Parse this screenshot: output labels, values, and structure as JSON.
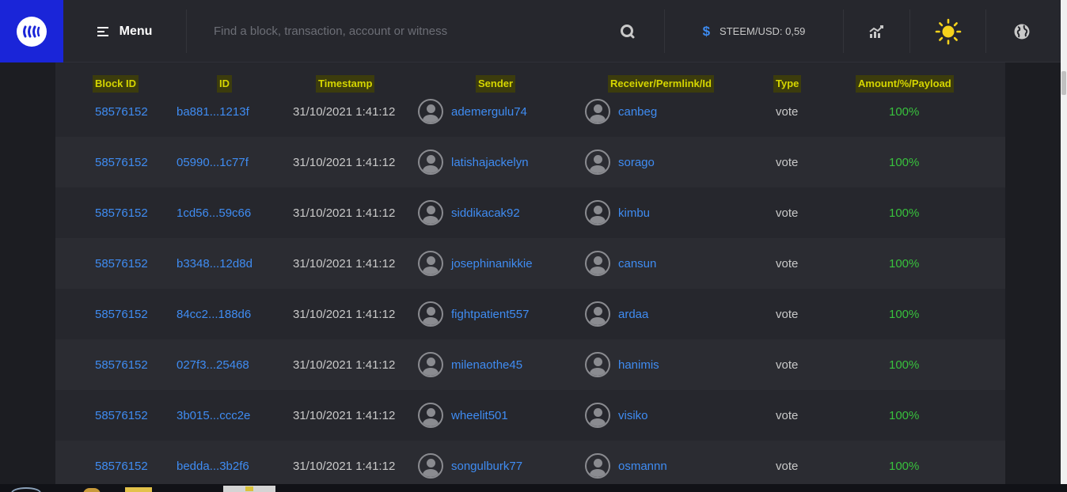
{
  "header": {
    "menu_label": "Menu",
    "search_placeholder": "Find a block, transaction, account or witness",
    "price_label": "STEEM/USD: 0,59",
    "currency_symbol": "$"
  },
  "table": {
    "columns": [
      "Block ID",
      "ID",
      "Timestamp",
      "Sender",
      "Receiver/Permlink/Id",
      "Type",
      "Amount/%/Payload"
    ],
    "rows": [
      {
        "block": "58576152",
        "id": "ba881...1213f",
        "time": "31/10/2021 1:41:12",
        "sender": "ademergulu74",
        "receiver": "canbeg",
        "type": "vote",
        "amount": "100%"
      },
      {
        "block": "58576152",
        "id": "05990...1c77f",
        "time": "31/10/2021 1:41:12",
        "sender": "latishajackelyn",
        "receiver": "sorago",
        "type": "vote",
        "amount": "100%"
      },
      {
        "block": "58576152",
        "id": "1cd56...59c66",
        "time": "31/10/2021 1:41:12",
        "sender": "siddikacak92",
        "receiver": "kimbu",
        "type": "vote",
        "amount": "100%"
      },
      {
        "block": "58576152",
        "id": "b3348...12d8d",
        "time": "31/10/2021 1:41:12",
        "sender": "josephinanikkie",
        "receiver": "cansun",
        "type": "vote",
        "amount": "100%"
      },
      {
        "block": "58576152",
        "id": "84cc2...188d6",
        "time": "31/10/2021 1:41:12",
        "sender": "fightpatient557",
        "receiver": "ardaa",
        "type": "vote",
        "amount": "100%"
      },
      {
        "block": "58576152",
        "id": "027f3...25468",
        "time": "31/10/2021 1:41:12",
        "sender": "milenaothe45",
        "receiver": "hanimis",
        "type": "vote",
        "amount": "100%"
      },
      {
        "block": "58576152",
        "id": "3b015...ccc2e",
        "time": "31/10/2021 1:41:12",
        "sender": "wheelit501",
        "receiver": "visiko",
        "type": "vote",
        "amount": "100%"
      },
      {
        "block": "58576152",
        "id": "bedda...3b2f6",
        "time": "31/10/2021 1:41:12",
        "sender": "songulburk77",
        "receiver": "osmannn",
        "type": "vote",
        "amount": "100%"
      }
    ]
  },
  "colors": {
    "accent_blue": "#1a25d8",
    "link": "#3f8cf2",
    "amount_green": "#38c13d",
    "header_highlight": "#d6d600",
    "sun": "#f5d21c"
  },
  "icons": [
    "steem-logo-icon",
    "menu-icon",
    "search-icon",
    "dollar-icon",
    "chart-icon",
    "sun-icon",
    "globe-icon",
    "avatar-icon"
  ]
}
